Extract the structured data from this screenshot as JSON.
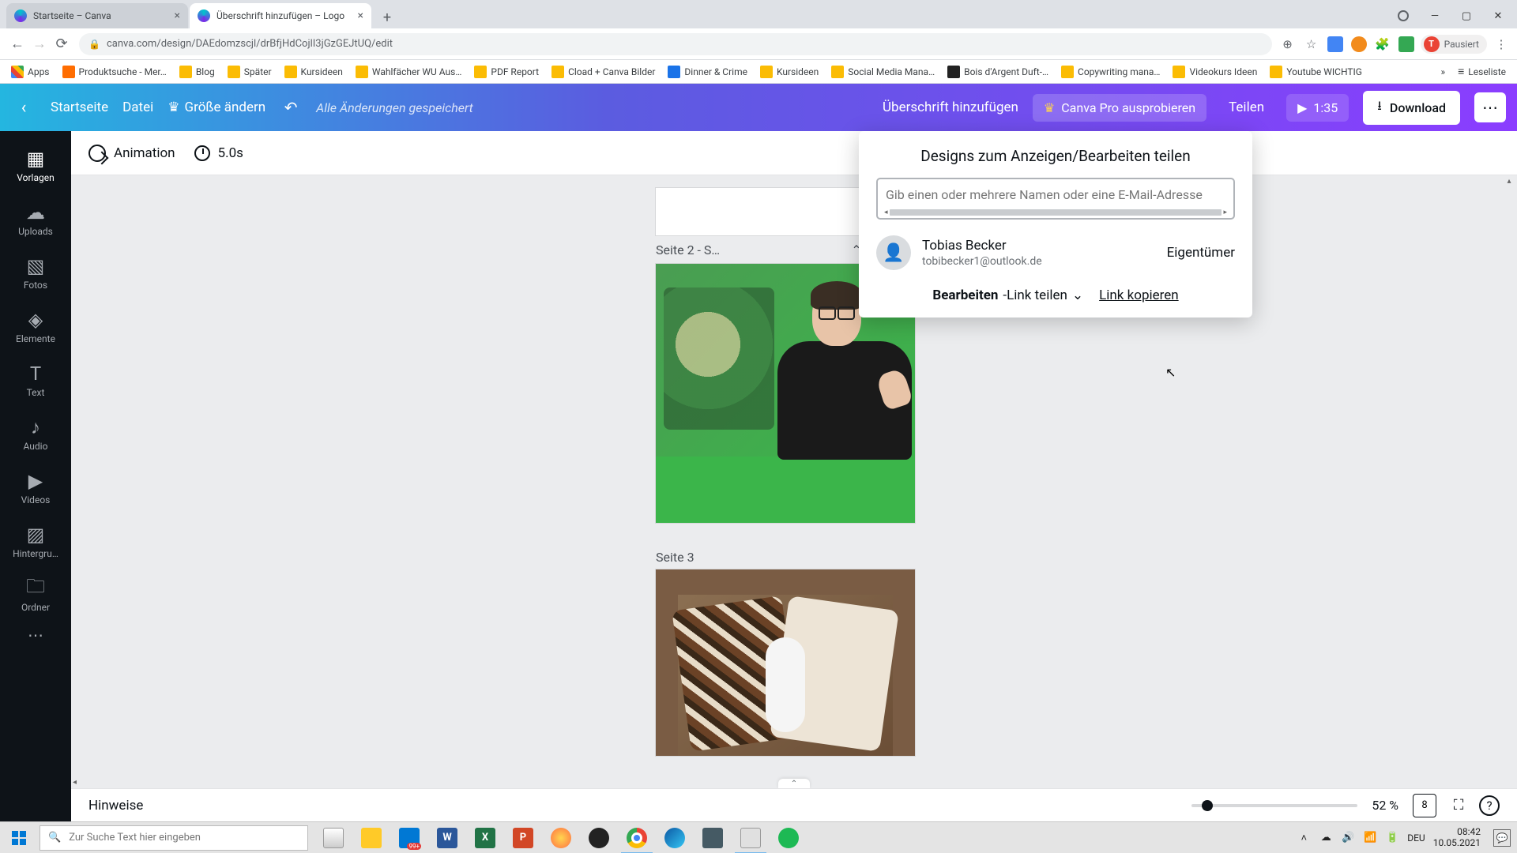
{
  "browser": {
    "tabs": [
      {
        "title": "Startseite – Canva",
        "active": false
      },
      {
        "title": "Überschrift hinzufügen – Logo",
        "active": true
      }
    ],
    "url": "canva.com/design/DAEdomzscjl/drBfjHdCojlI3jGzGEJtUQ/edit",
    "profile_status": "Pausiert",
    "profile_initial": "T"
  },
  "bookmarks": {
    "apps": "Apps",
    "items": [
      "Produktsuche - Mer…",
      "Blog",
      "Später",
      "Kursideen",
      "Wahlfächer WU Aus…",
      "PDF Report",
      "Cload + Canva Bilder",
      "Dinner & Crime",
      "Kursideen",
      "Social Media Mana…",
      "Bois d'Argent Duft-…",
      "Copywriting mana…",
      "Videokurs Ideen",
      "Youtube WICHTIG"
    ],
    "reading_list": "Leseliste"
  },
  "canva": {
    "home": "Startseite",
    "file": "Datei",
    "resize": "Größe ändern",
    "saved": "Alle Änderungen gespeichert",
    "title": "Überschrift hinzufügen",
    "try_pro": "Canva Pro ausprobieren",
    "share": "Teilen",
    "duration": "1:35",
    "download": "Download"
  },
  "side": {
    "items": [
      "Vorlagen",
      "Uploads",
      "Fotos",
      "Elemente",
      "Text",
      "Audio",
      "Videos",
      "Hintergru…",
      "Ordner"
    ]
  },
  "toolbar": {
    "animation": "Animation",
    "dur": "5.0s"
  },
  "pages": {
    "p2_label": "Seite 2 - S…",
    "p3_label": "Seite 3"
  },
  "share_pop": {
    "title": "Designs zum Anzeigen/Bearbeiten teilen",
    "placeholder": "Gib einen oder mehrere Namen oder eine E-Mail-Adresse",
    "user_name": "Tobias Becker",
    "user_email": "tobibecker1@outlook.de",
    "user_role": "Eigentümer",
    "perm_bold": "Bearbeiten",
    "perm_rest": "-Link teilen",
    "copy": "Link kopieren"
  },
  "bottom": {
    "notes": "Hinweise",
    "zoom": "52 %",
    "page_count": "8"
  },
  "taskbar": {
    "search_placeholder": "Zur Suche Text hier eingeben",
    "lang": "DEU",
    "time": "08:42",
    "date": "10.05.2021"
  }
}
